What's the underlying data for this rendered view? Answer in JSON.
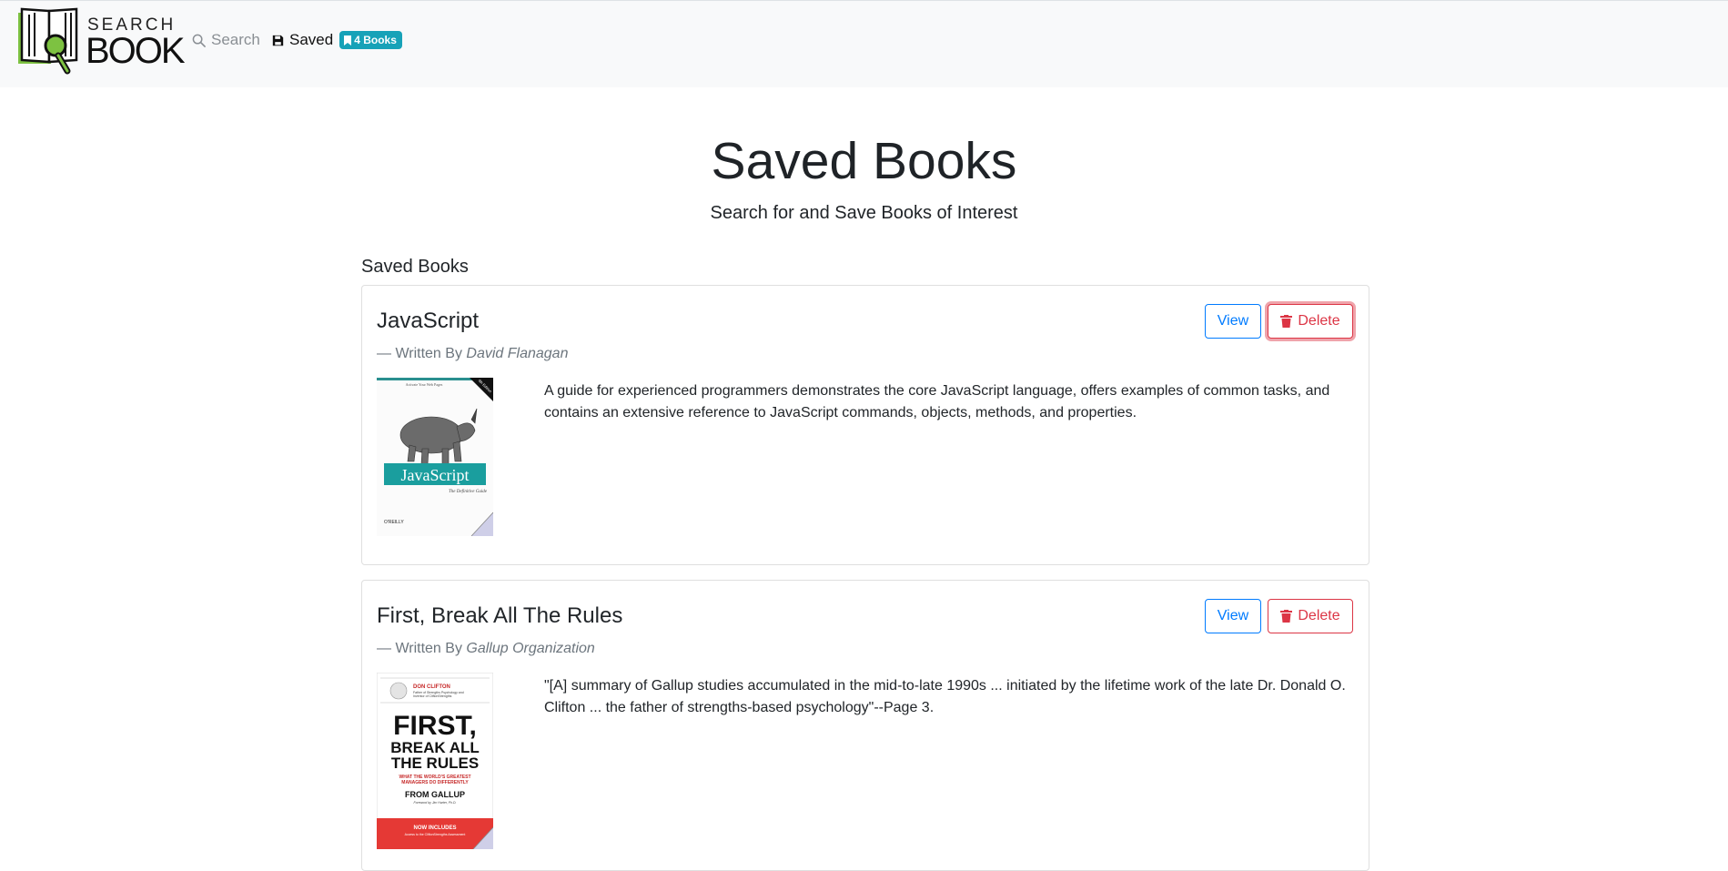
{
  "nav": {
    "logo_top": "SEARCH",
    "logo_bottom": "BOOK",
    "search_label": "Search",
    "saved_label": "Saved",
    "saved_count_badge": "4 Books"
  },
  "hero": {
    "title": "Saved Books",
    "subtitle": "Search for and Save Books of Interest"
  },
  "section_heading": "Saved Books",
  "books": [
    {
      "title": "JavaScript",
      "author_prefix": "— Written By",
      "author": "David Flanagan",
      "view_label": "View",
      "delete_label": "Delete",
      "description": "A guide for experienced programmers demonstrates the core JavaScript language, offers examples of common tasks, and contains an extensive reference to JavaScript commands, objects, methods, and properties.",
      "cover": {
        "topline": "Activate Your Web Pages",
        "corner": "6th Edition",
        "title": "JavaScript",
        "subtitle": "The Definitive Guide",
        "publisher": "O'REILLY"
      }
    },
    {
      "title": "First, Break All The Rules",
      "author_prefix": "— Written By",
      "author": "Gallup Organization",
      "view_label": "View",
      "delete_label": "Delete",
      "description": "\"[A] summary of Gallup studies accumulated in the mid-to-late 1990s ... initiated by the lifetime work of the late Dr. Donald O. Clifton ... the father of strengths-based psychology\"--Page 3.",
      "cover": {
        "author": "DON CLIFTON",
        "author_note1": "Father of Strengths Psychology and",
        "author_note2": "Inventor of CliftonStrengths",
        "title1": "FIRST,",
        "title2": "BREAK ALL",
        "title3": "THE RULES",
        "tagline1": "WHAT THE WORLD'S GREATEST",
        "tagline2": "MANAGERS DO DIFFERENTLY",
        "from": "FROM GALLUP",
        "foreword": "Foreword by Jim Harter, Ph.D.",
        "band1": "NOW INCLUDES",
        "band2": "Access to the CliftonStrengths Assessment"
      }
    }
  ],
  "colors": {
    "navbar_bg": "#f8f9fa",
    "badge": "#17a2b8",
    "primary": "#007bff",
    "danger": "#dc3545",
    "logo_green": "#7dc241"
  },
  "icons": {
    "search": "magnifier-icon",
    "saved": "floppy-disk-icon",
    "badge": "bookmark-icon",
    "delete": "trash-icon"
  }
}
